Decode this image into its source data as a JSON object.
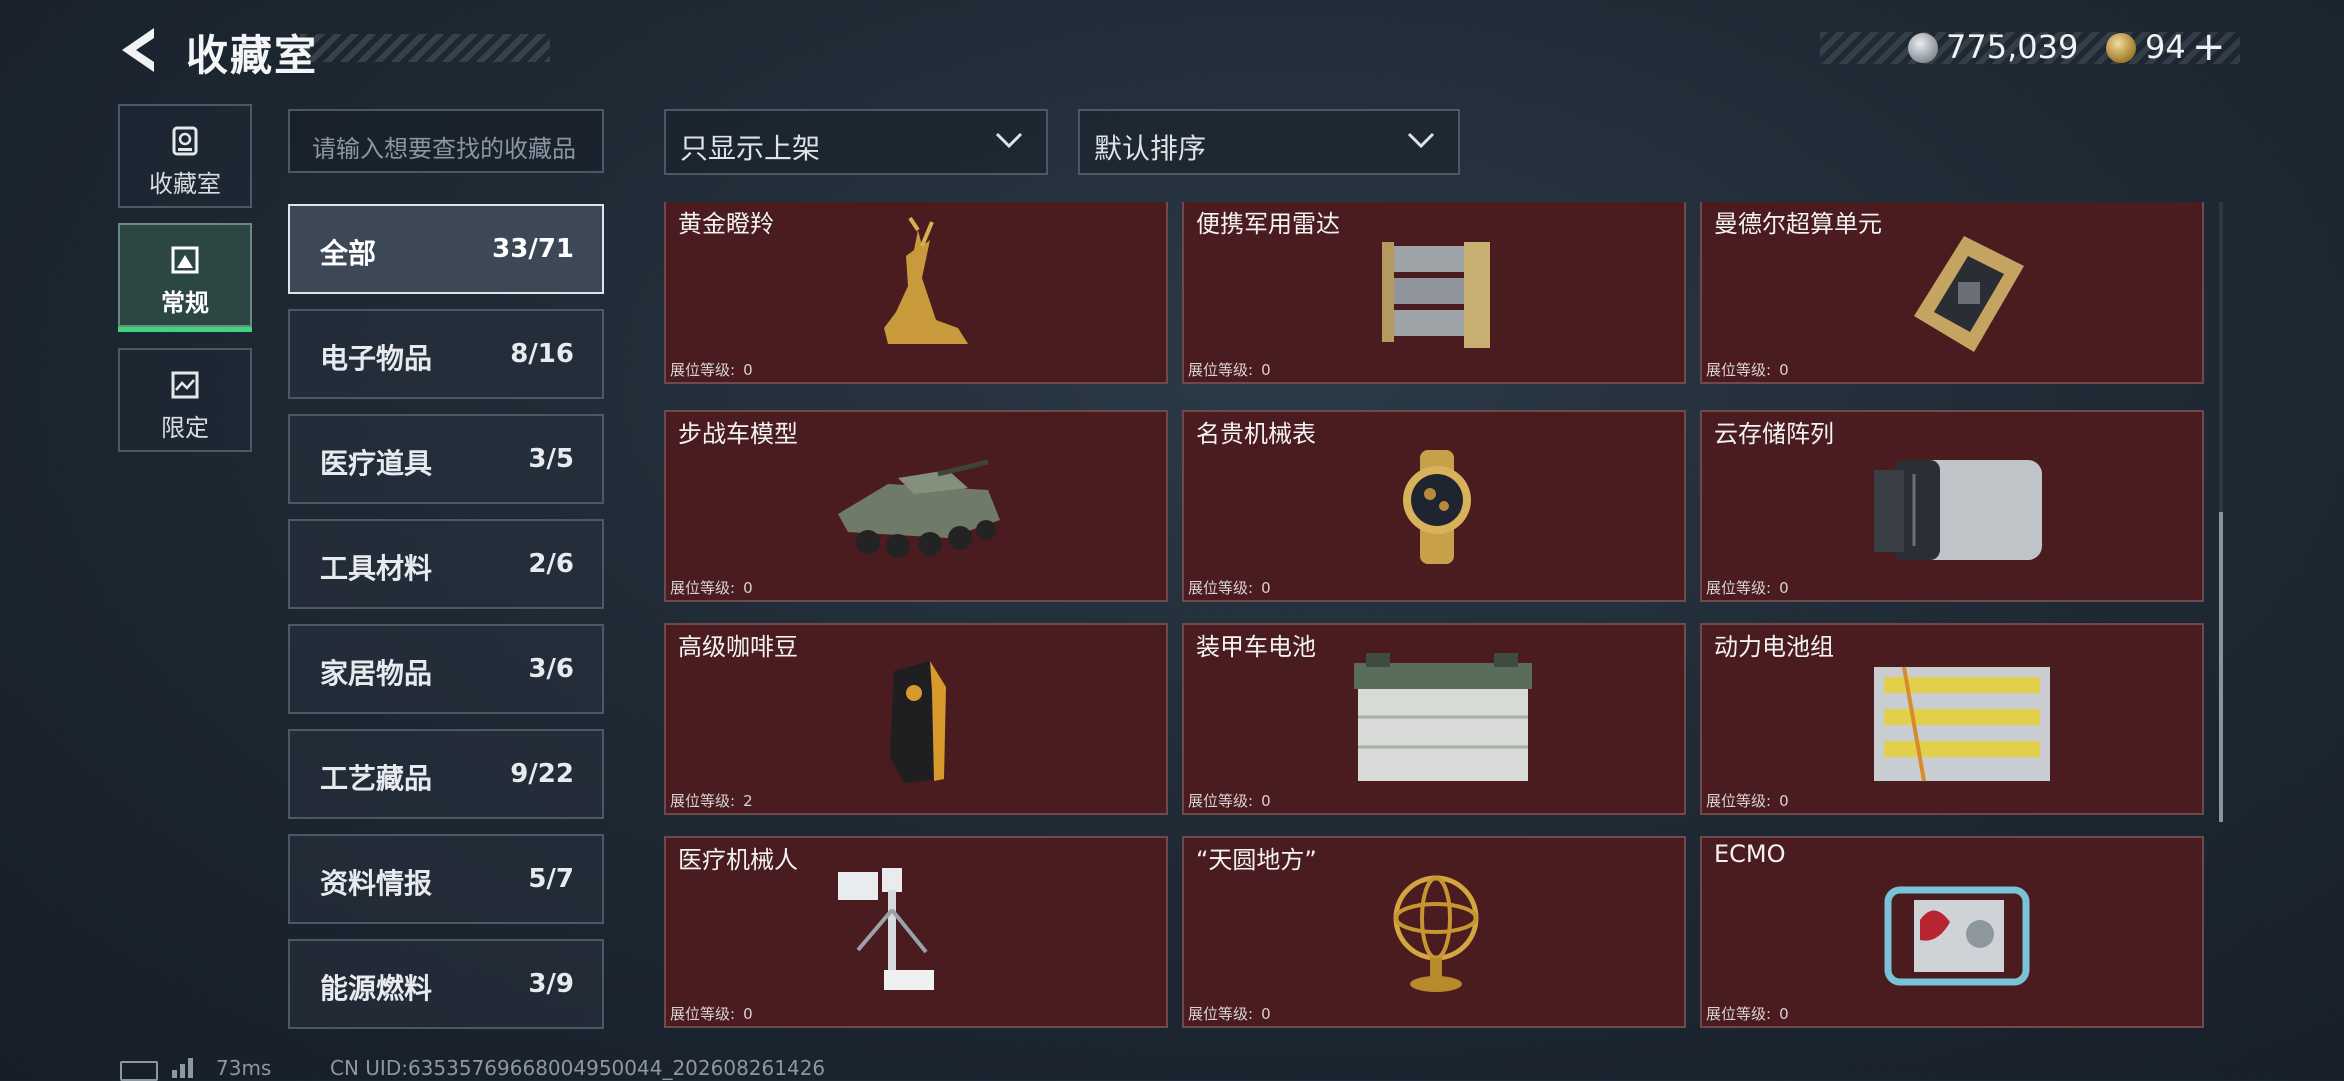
{
  "header": {
    "title": "收藏室",
    "currency": [
      {
        "icon": "silver-coin-icon",
        "value": "775,039"
      },
      {
        "icon": "gold-coin-icon",
        "value": "94"
      }
    ],
    "add_label": "+"
  },
  "nav": [
    {
      "label": "收藏室",
      "icon": "vault-icon",
      "active": false
    },
    {
      "label": "常规",
      "icon": "picture-frame-icon",
      "active": true
    },
    {
      "label": "限定",
      "icon": "limited-frame-icon",
      "active": false
    }
  ],
  "search": {
    "placeholder": "请输入想要查找的收藏品"
  },
  "filters": {
    "display": "只显示上架",
    "sort": "默认排序"
  },
  "categories": [
    {
      "name": "全部",
      "count": "33/71",
      "active": true
    },
    {
      "name": "电子物品",
      "count": "8/16"
    },
    {
      "name": "医疗道具",
      "count": "3/5"
    },
    {
      "name": "工具材料",
      "count": "2/6"
    },
    {
      "name": "家居物品",
      "count": "3/6"
    },
    {
      "name": "工艺藏品",
      "count": "9/22"
    },
    {
      "name": "资料情报",
      "count": "5/7"
    },
    {
      "name": "能源燃料",
      "count": "3/9"
    }
  ],
  "level_label": "展位等级:",
  "items": [
    {
      "name": "黄金瞪羚",
      "level": "0",
      "icon": "golden-gazelle-icon"
    },
    {
      "name": "便携军用雷达",
      "level": "0",
      "icon": "military-radar-icon"
    },
    {
      "name": "曼德尔超算单元",
      "level": "0",
      "icon": "supercomputer-unit-icon"
    },
    {
      "name": "步战车模型",
      "level": "0",
      "icon": "ifv-model-icon"
    },
    {
      "name": "名贵机械表",
      "level": "0",
      "icon": "mechanical-watch-icon"
    },
    {
      "name": "云存储阵列",
      "level": "0",
      "icon": "cloud-storage-array-icon"
    },
    {
      "name": "高级咖啡豆",
      "level": "2",
      "icon": "coffee-bag-icon"
    },
    {
      "name": "装甲车电池",
      "level": "0",
      "icon": "vehicle-battery-icon"
    },
    {
      "name": "动力电池组",
      "level": "0",
      "icon": "power-battery-pack-icon"
    },
    {
      "name": "医疗机械人",
      "level": "0",
      "icon": "medical-robot-icon"
    },
    {
      "name": "“天圆地方”",
      "level": "0",
      "icon": "armillary-sphere-icon"
    },
    {
      "name": "ECMO",
      "level": "0",
      "icon": "ecmo-machine-icon"
    }
  ],
  "footer": {
    "ping": "73ms",
    "uid": "CN UID:635357696680049500​44_202608261426"
  }
}
